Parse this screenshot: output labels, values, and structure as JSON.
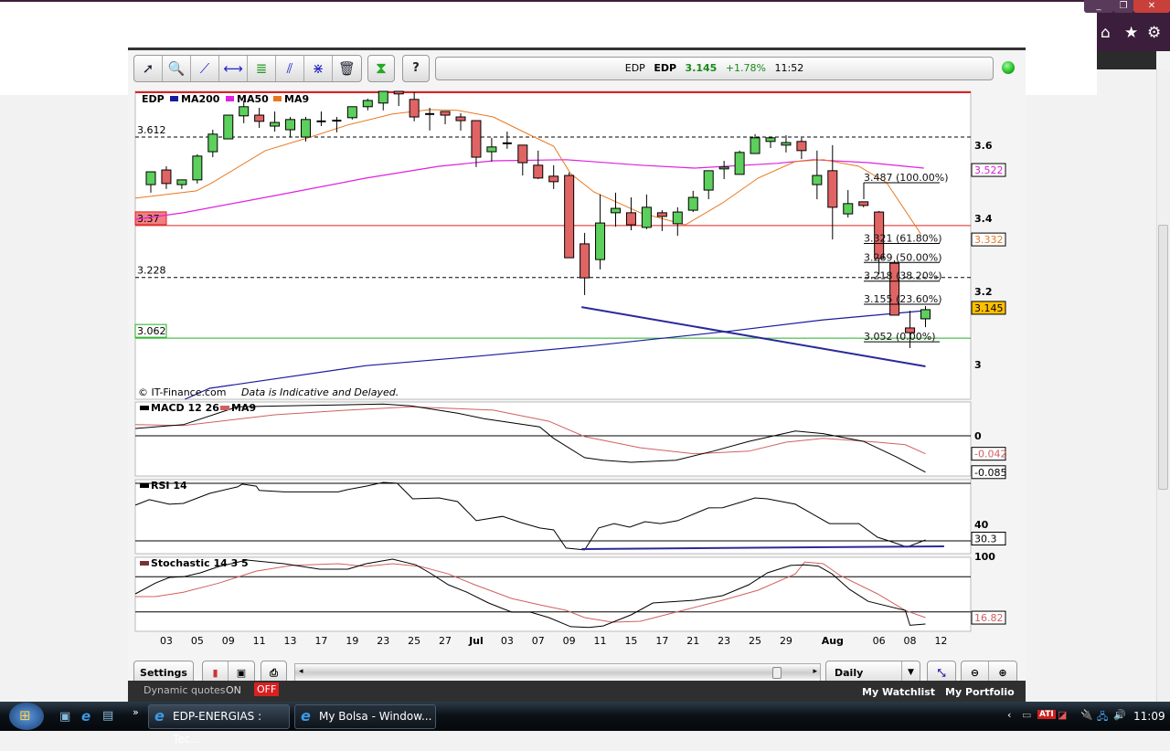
{
  "toolbar": {
    "tools": [
      "pointer-tool",
      "zoom-tool",
      "trendline-tool",
      "horizontal-line-tool",
      "fibonacci-tool",
      "parallel-channel-tool",
      "cross-lines-tool",
      "delete-tool"
    ],
    "quote": {
      "exchange_symbol": "EDP",
      "symbol": "EDP",
      "price": "3.145",
      "change": "+1.78%",
      "time": "11:52"
    },
    "colors": {
      "up": "#1a8a1a"
    }
  },
  "bottom_bar": {
    "settings_label": "Settings",
    "period_selected": "Daily"
  },
  "site_strip": {
    "dynamic_quotes_label": "Dynamic quotes",
    "on_label": "ON",
    "off_label": "OFF",
    "watchlist_label": "My Watchlist",
    "portfolio_label": "My Portfolio"
  },
  "taskbar": {
    "tasks": [
      "EDP-ENERGIAS : Tec...",
      "My Bolsa - Window..."
    ],
    "clock": "11:09"
  },
  "chart_data": {
    "type": "candlestick",
    "price_panel": {
      "legend": {
        "symbol": "EDP",
        "ma200": "MA200",
        "ma50": "MA50",
        "ma9": "MA9"
      },
      "colors": {
        "ma200": "#1a1aa0",
        "ma50": "#e020e0",
        "ma9": "#e87820",
        "up": "#5ccf5c",
        "down": "#e06464"
      },
      "ylim": [
        2.895,
        3.737
      ],
      "y_ticks": [
        "3.6",
        "3.4",
        "3.2",
        "3"
      ],
      "y_tick_values": [
        3.6,
        3.4,
        3.2,
        3.0
      ],
      "copyright": "© IT-Finance.com",
      "disclaimer": "Data is Indicative and Delayed.",
      "candles_ohlc": [
        [
          3.482,
          3.517,
          3.46,
          3.517
        ],
        [
          3.522,
          3.532,
          3.47,
          3.485
        ],
        [
          3.482,
          3.495,
          3.47,
          3.495
        ],
        [
          3.495,
          3.565,
          3.485,
          3.56
        ],
        [
          3.572,
          3.632,
          3.557,
          3.62
        ],
        [
          3.607,
          3.672,
          3.607,
          3.672
        ],
        [
          3.67,
          3.712,
          3.65,
          3.695
        ],
        [
          3.672,
          3.692,
          3.637,
          3.655
        ],
        [
          3.642,
          3.682,
          3.627,
          3.652
        ],
        [
          3.632,
          3.667,
          3.612,
          3.66
        ],
        [
          3.612,
          3.667,
          3.6,
          3.66
        ],
        [
          3.655,
          3.682,
          3.642,
          3.654
        ],
        [
          3.657,
          3.667,
          3.625,
          3.656
        ],
        [
          3.665,
          3.695,
          3.66,
          3.695
        ],
        [
          3.695,
          3.717,
          3.685,
          3.712
        ],
        [
          3.705,
          3.737,
          3.685,
          3.737
        ],
        [
          3.737,
          3.737,
          3.697,
          3.73
        ],
        [
          3.715,
          3.735,
          3.655,
          3.667
        ],
        [
          3.675,
          3.692,
          3.63,
          3.674
        ],
        [
          3.682,
          3.682,
          3.647,
          3.672
        ],
        [
          3.667,
          3.677,
          3.63,
          3.657
        ],
        [
          3.657,
          3.657,
          3.53,
          3.557
        ],
        [
          3.572,
          3.61,
          3.545,
          3.585
        ],
        [
          3.595,
          3.627,
          3.58,
          3.594
        ],
        [
          3.59,
          3.59,
          3.507,
          3.542
        ],
        [
          3.535,
          3.575,
          3.497,
          3.5
        ],
        [
          3.505,
          3.535,
          3.47,
          3.49
        ],
        [
          3.507,
          3.515,
          3.282,
          3.282
        ],
        [
          3.32,
          3.35,
          3.18,
          3.227
        ],
        [
          3.277,
          3.455,
          3.25,
          3.377
        ],
        [
          3.405,
          3.46,
          3.367,
          3.417
        ],
        [
          3.405,
          3.447,
          3.357,
          3.372
        ],
        [
          3.365,
          3.455,
          3.36,
          3.42
        ],
        [
          3.405,
          3.412,
          3.355,
          3.395
        ],
        [
          3.375,
          3.42,
          3.342,
          3.407
        ],
        [
          3.412,
          3.465,
          3.407,
          3.447
        ],
        [
          3.467,
          3.52,
          3.442,
          3.52
        ],
        [
          3.525,
          3.547,
          3.497,
          3.53
        ],
        [
          3.51,
          3.575,
          3.51,
          3.57
        ],
        [
          3.567,
          3.62,
          3.567,
          3.61
        ],
        [
          3.6,
          3.61,
          3.582,
          3.61
        ],
        [
          3.59,
          3.617,
          3.57,
          3.597
        ],
        [
          3.6,
          3.61,
          3.552,
          3.575
        ],
        [
          3.482,
          3.575,
          3.442,
          3.507
        ],
        [
          3.52,
          3.59,
          3.332,
          3.42
        ],
        [
          3.402,
          3.467,
          3.392,
          3.43
        ],
        [
          3.435,
          3.435,
          3.42,
          3.425
        ],
        [
          3.407,
          3.41,
          3.237,
          3.28
        ],
        [
          3.267,
          3.275,
          3.125,
          3.125
        ],
        [
          3.09,
          3.137,
          3.035,
          3.077
        ],
        [
          3.115,
          3.15,
          3.092,
          3.14
        ]
      ],
      "ma9": [
        [
          -1,
          3.445
        ],
        [
          2.95,
          3.465
        ],
        [
          3.95,
          3.487
        ],
        [
          7.4,
          3.575
        ],
        [
          10.3,
          3.612
        ],
        [
          12.7,
          3.645
        ],
        [
          15.6,
          3.675
        ],
        [
          18,
          3.687
        ],
        [
          19.8,
          3.685
        ],
        [
          22.1,
          3.667
        ],
        [
          24.5,
          3.617
        ],
        [
          26,
          3.587
        ],
        [
          27.1,
          3.512
        ],
        [
          28.6,
          3.462
        ],
        [
          31.6,
          3.405
        ],
        [
          34.5,
          3.372
        ],
        [
          36.9,
          3.432
        ],
        [
          39.2,
          3.5
        ],
        [
          41.6,
          3.545
        ],
        [
          43.4,
          3.55
        ],
        [
          45.7,
          3.532
        ],
        [
          47.5,
          3.487
        ],
        [
          49.7,
          3.347
        ]
      ],
      "ma50": [
        [
          -1,
          3.387
        ],
        [
          2.1,
          3.405
        ],
        [
          8,
          3.452
        ],
        [
          13.9,
          3.5
        ],
        [
          18.6,
          3.532
        ],
        [
          22.1,
          3.547
        ],
        [
          26.8,
          3.55
        ],
        [
          31.6,
          3.535
        ],
        [
          35.1,
          3.527
        ],
        [
          40.4,
          3.54
        ],
        [
          42.8,
          3.55
        ],
        [
          46.3,
          3.542
        ],
        [
          49.9,
          3.527
        ]
      ],
      "ma200": [
        [
          2.2,
          2.895
        ],
        [
          3.8,
          2.925
        ],
        [
          13.9,
          2.987
        ],
        [
          20.9,
          3.012
        ],
        [
          28.6,
          3.042
        ],
        [
          37.5,
          3.082
        ],
        [
          43.4,
          3.112
        ],
        [
          49.9,
          3.137
        ]
      ],
      "trendline": [
        [
          27.8,
          3.147
        ],
        [
          50,
          2.985
        ]
      ],
      "levels": [
        {
          "value": 3.612,
          "label": "3.612",
          "style": "dashed",
          "color": "#000"
        },
        {
          "value": 3.228,
          "label": "3.228",
          "style": "dashed",
          "color": "#000"
        },
        {
          "value": 3.37,
          "label": "3.37",
          "style": "solid",
          "color": "#e02020"
        },
        {
          "value": 3.062,
          "label": "3.062",
          "style": "solid",
          "color": "#20b020"
        }
      ],
      "fibonacci": [
        {
          "value": 3.487,
          "label": "3.487 (100.00%)"
        },
        {
          "value": 3.321,
          "label": "3.321 (61.80%)"
        },
        {
          "value": 3.269,
          "label": "3.269 (50.00%)"
        },
        {
          "value": 3.218,
          "label": "3.218 (38.20%)"
        },
        {
          "value": 3.155,
          "label": "3.155 (23.60%)"
        },
        {
          "value": 3.052,
          "label": "3.052 (0.00%)"
        }
      ],
      "value_badges": [
        {
          "value": 3.522,
          "label": "3.522",
          "color": "#d020d0",
          "bg": "#fff"
        },
        {
          "value": 3.332,
          "label": "3.332",
          "color": "#e87820",
          "bg": "#fff"
        },
        {
          "value": 3.145,
          "label": "3.145",
          "color": "#000",
          "bg": "#ffc000"
        }
      ]
    },
    "macd_panel": {
      "title": "MACD 12 26",
      "signal_title": "MA9",
      "ylim": [
        -0.094,
        0.079
      ],
      "zero_label": "0",
      "macd": [
        [
          -1,
          0.017
        ],
        [
          2.1,
          0.026
        ],
        [
          5.6,
          0.068
        ],
        [
          8.6,
          0.07
        ],
        [
          15,
          0.074
        ],
        [
          16.8,
          0.07
        ],
        [
          19.8,
          0.053
        ],
        [
          21.5,
          0.04
        ],
        [
          25.1,
          0.021
        ],
        [
          26,
          -0.006
        ],
        [
          28,
          -0.051
        ],
        [
          29.2,
          -0.057
        ],
        [
          31,
          -0.062
        ],
        [
          33.9,
          -0.057
        ],
        [
          36.3,
          -0.036
        ],
        [
          38.6,
          -0.013
        ],
        [
          41.6,
          0.011
        ],
        [
          43.4,
          0.005
        ],
        [
          46,
          -0.013
        ],
        [
          48.1,
          -0.049
        ],
        [
          50,
          -0.085
        ]
      ],
      "signal": [
        [
          -1,
          0.026
        ],
        [
          2.1,
          0.024
        ],
        [
          8,
          0.049
        ],
        [
          12.7,
          0.06
        ],
        [
          16.8,
          0.068
        ],
        [
          22.1,
          0.06
        ],
        [
          25.7,
          0.034
        ],
        [
          28,
          -0.002
        ],
        [
          31.6,
          -0.028
        ],
        [
          35.1,
          -0.042
        ],
        [
          38.6,
          -0.036
        ],
        [
          41,
          -0.015
        ],
        [
          43.4,
          -0.006
        ],
        [
          46.9,
          -0.015
        ],
        [
          48.7,
          -0.021
        ],
        [
          50,
          -0.042
        ]
      ],
      "badges": [
        {
          "value": -0.042,
          "label": "-0.042",
          "color": "#d06060"
        },
        {
          "value": -0.085,
          "label": "-0.085",
          "color": "#000"
        }
      ]
    },
    "rsi_panel": {
      "title": "RSI 14",
      "ylim": [
        21.1,
        72.5
      ],
      "levels": [
        30,
        70
      ],
      "tick_label": "40",
      "tick_value": 40,
      "rsi": [
        [
          -1,
          54.8
        ],
        [
          -0.1,
          58.6
        ],
        [
          1.2,
          55.4
        ],
        [
          2.1,
          56
        ],
        [
          3.8,
          63
        ],
        [
          5.6,
          67.5
        ],
        [
          5.9,
          69.4
        ],
        [
          6.8,
          68
        ],
        [
          7,
          65
        ],
        [
          8.6,
          64
        ],
        [
          12.1,
          64
        ],
        [
          12.7,
          65.6
        ],
        [
          13.9,
          68
        ],
        [
          15,
          70.6
        ],
        [
          15.9,
          70
        ],
        [
          16.9,
          59.2
        ],
        [
          18.6,
          59.8
        ],
        [
          19.8,
          57.3
        ],
        [
          21,
          44
        ],
        [
          22.7,
          47
        ],
        [
          23.9,
          42.7
        ],
        [
          25.1,
          38.9
        ],
        [
          26,
          37.6
        ],
        [
          26.8,
          25
        ],
        [
          28,
          23.7
        ],
        [
          28.9,
          38.9
        ],
        [
          29.9,
          42
        ],
        [
          30.9,
          39.5
        ],
        [
          31.9,
          43.3
        ],
        [
          32.9,
          42
        ],
        [
          34,
          44
        ],
        [
          36,
          52.9
        ],
        [
          36.9,
          53
        ],
        [
          39,
          59.8
        ],
        [
          39.8,
          59.2
        ],
        [
          41.6,
          55.4
        ],
        [
          43.8,
          42
        ],
        [
          45.7,
          42
        ],
        [
          46.9,
          32.5
        ],
        [
          47.8,
          29.4
        ],
        [
          48.8,
          25.6
        ],
        [
          50,
          30.6
        ]
      ],
      "trendline": [
        [
          27.8,
          24.3
        ],
        [
          51.2,
          26.2
        ]
      ],
      "badge": {
        "value": 30.3,
        "label": "30.3"
      }
    },
    "stochastic_panel": {
      "title": "Stochastic 14 3 5",
      "ylim": [
        -2.6,
        102.6
      ],
      "levels": [
        25,
        75
      ],
      "tick_label": "100",
      "tick_value": 100,
      "k": [
        [
          -1,
          50.6
        ],
        [
          0.3,
          66
        ],
        [
          1.2,
          74
        ],
        [
          2.1,
          75
        ],
        [
          3.2,
          80.5
        ],
        [
          4.4,
          89.6
        ],
        [
          6.2,
          98.7
        ],
        [
          8.6,
          93.5
        ],
        [
          10.9,
          85.7
        ],
        [
          12.7,
          85.7
        ],
        [
          13.9,
          93.5
        ],
        [
          15.6,
          100
        ],
        [
          17.1,
          92
        ],
        [
          18,
          80.5
        ],
        [
          19.2,
          63.6
        ],
        [
          20.4,
          53
        ],
        [
          21.8,
          37.7
        ],
        [
          23.3,
          24.7
        ],
        [
          24.5,
          24.7
        ],
        [
          25.7,
          16.9
        ],
        [
          27.1,
          4
        ],
        [
          28.3,
          3
        ],
        [
          29.2,
          5
        ],
        [
          31,
          20.8
        ],
        [
          32.4,
          37.7
        ],
        [
          35.1,
          41.6
        ],
        [
          36.9,
          48
        ],
        [
          38.6,
          63.6
        ],
        [
          39.8,
          80.5
        ],
        [
          41.3,
          91
        ],
        [
          42.2,
          92
        ],
        [
          43.1,
          90
        ],
        [
          43.97,
          79
        ],
        [
          45.1,
          57
        ],
        [
          46.3,
          40
        ],
        [
          48.7,
          27
        ],
        [
          49,
          6
        ],
        [
          50,
          7.8
        ]
      ],
      "d": [
        [
          -1,
          46.8
        ],
        [
          0.3,
          46.8
        ],
        [
          2.1,
          53
        ],
        [
          4.4,
          66
        ],
        [
          6.8,
          83
        ],
        [
          9.1,
          91
        ],
        [
          12.1,
          93.5
        ],
        [
          13.9,
          89.6
        ],
        [
          15.6,
          93.5
        ],
        [
          17.4,
          89.6
        ],
        [
          19.2,
          79
        ],
        [
          20.9,
          63.6
        ],
        [
          23.3,
          44
        ],
        [
          25.1,
          35
        ],
        [
          26.8,
          27.3
        ],
        [
          28,
          16.9
        ],
        [
          29.8,
          10.4
        ],
        [
          31.6,
          11.7
        ],
        [
          33.9,
          24.7
        ],
        [
          36.9,
          41.6
        ],
        [
          39.2,
          55.8
        ],
        [
          41.6,
          79
        ],
        [
          42.2,
          96
        ],
        [
          43.4,
          93.5
        ],
        [
          44.5,
          76.6
        ],
        [
          46.9,
          50.6
        ],
        [
          48.7,
          27
        ],
        [
          50,
          16.9
        ]
      ],
      "badge": {
        "value": 16.82,
        "label": "16.82"
      }
    },
    "x_ticks": [
      [
        1,
        "03"
      ],
      [
        3,
        "05"
      ],
      [
        5,
        "09"
      ],
      [
        7,
        "11"
      ],
      [
        9,
        "13"
      ],
      [
        11,
        "17"
      ],
      [
        13,
        "19"
      ],
      [
        15,
        "23"
      ],
      [
        17,
        "25"
      ],
      [
        19,
        "27"
      ],
      [
        21,
        "Jul"
      ],
      [
        23,
        "03"
      ],
      [
        25,
        "07"
      ],
      [
        27,
        "09"
      ],
      [
        29,
        "11"
      ],
      [
        31,
        "15"
      ],
      [
        33,
        "17"
      ],
      [
        35,
        "21"
      ],
      [
        37,
        "23"
      ],
      [
        39,
        "25"
      ],
      [
        41,
        "29"
      ],
      [
        44,
        "Aug"
      ],
      [
        47,
        "06"
      ],
      [
        49,
        "08"
      ],
      [
        51,
        "12"
      ]
    ]
  }
}
